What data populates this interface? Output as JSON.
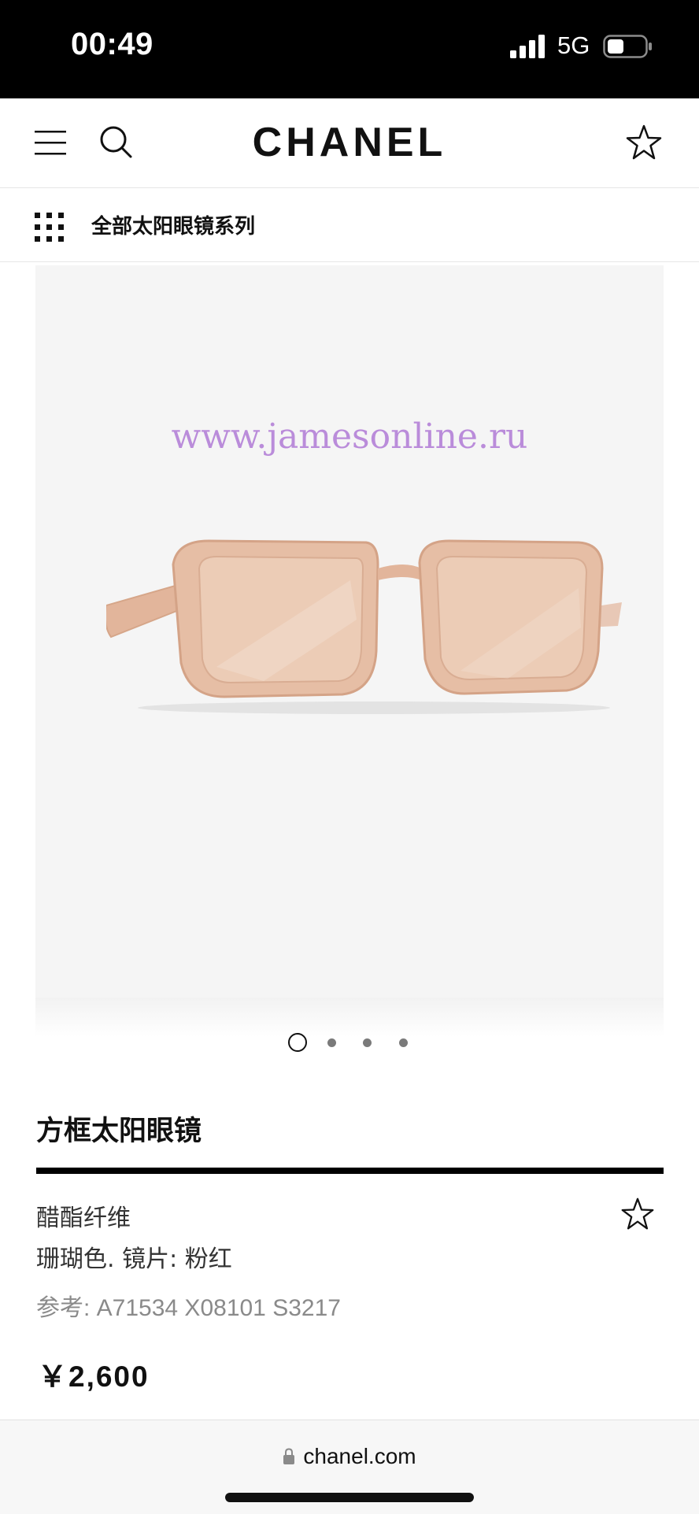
{
  "status_bar": {
    "time": "00:49",
    "network": "5G"
  },
  "header": {
    "logo": "CHANEL"
  },
  "collection": {
    "label": "全部太阳眼镜系列"
  },
  "product_image": {
    "watermark": "www.jamesonline.ru",
    "frame_color": "#e8bfa6",
    "lens_color": "#e9c3ad"
  },
  "carousel": {
    "total": 4,
    "active_index": 1
  },
  "product": {
    "title": "方框太阳眼镜",
    "material": "醋酯纤维",
    "color": "珊瑚色. 镜片: 粉红",
    "reference": "参考: A71534 X08101 S3217",
    "price": "￥2,600"
  },
  "browser": {
    "url": "chanel.com"
  }
}
